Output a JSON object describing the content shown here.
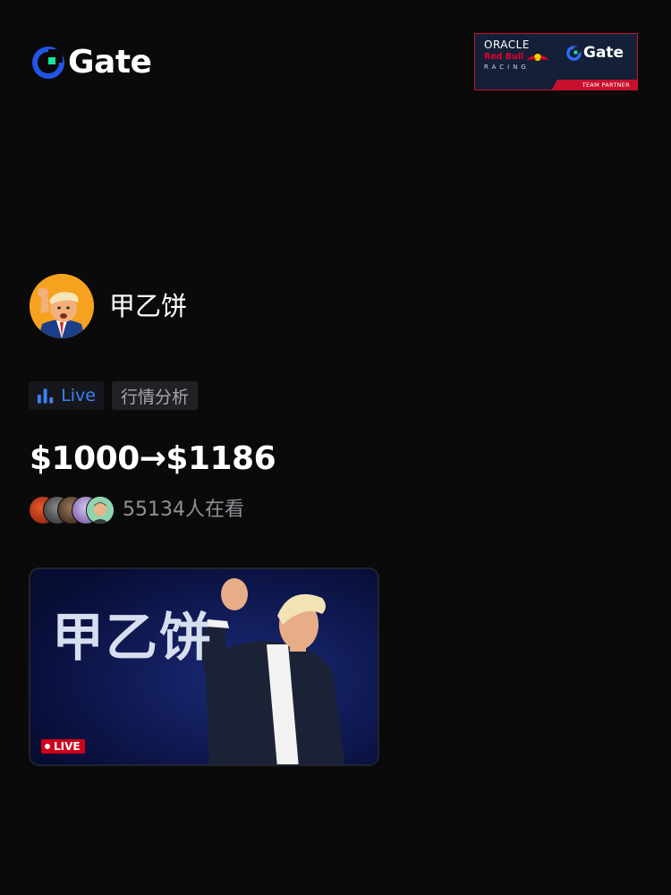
{
  "header": {
    "brand": "Gate",
    "partner_badge": {
      "oracle": "ORACLE",
      "redbull": "Red Bull",
      "racing": "RACING",
      "gate": "Gate",
      "team_partner": "TEAM PARTNER"
    }
  },
  "host": {
    "name": "甲乙饼",
    "avatar_icon": "trump-cartoon-avatar"
  },
  "tags": {
    "live_label": "Live",
    "category": "行情分析"
  },
  "stream": {
    "title": "$1000→$1186",
    "viewer_count": "55134人在看",
    "card_title": "甲乙饼",
    "live_badge": "LIVE"
  },
  "colors": {
    "background": "#0a0a0a",
    "accent_blue": "#3b82f6",
    "gate_green": "#17e7a1",
    "live_red": "#d0021b",
    "card_bg": "#0a1240"
  }
}
